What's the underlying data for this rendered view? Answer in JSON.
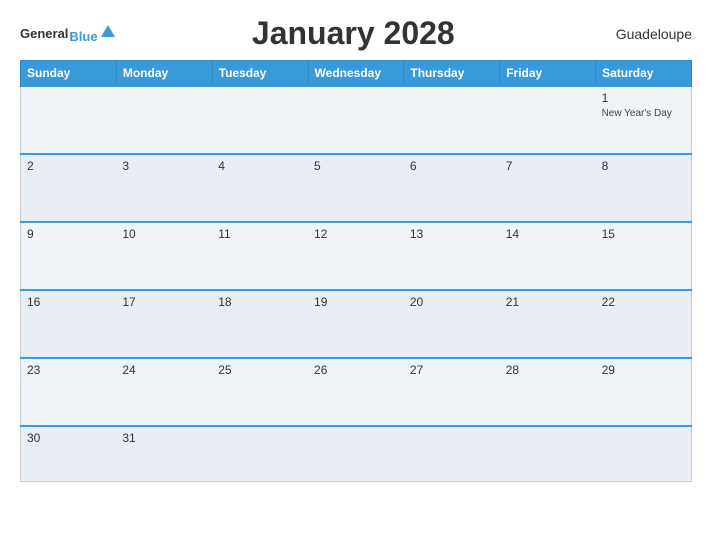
{
  "header": {
    "title": "January 2028",
    "region": "Guadeloupe",
    "logo": {
      "general": "General",
      "blue": "Blue"
    }
  },
  "days_of_week": [
    "Sunday",
    "Monday",
    "Tuesday",
    "Wednesday",
    "Thursday",
    "Friday",
    "Saturday"
  ],
  "weeks": [
    [
      {
        "date": "",
        "events": []
      },
      {
        "date": "",
        "events": []
      },
      {
        "date": "",
        "events": []
      },
      {
        "date": "",
        "events": []
      },
      {
        "date": "",
        "events": []
      },
      {
        "date": "",
        "events": []
      },
      {
        "date": "1",
        "events": [
          "New Year's Day"
        ]
      }
    ],
    [
      {
        "date": "2",
        "events": []
      },
      {
        "date": "3",
        "events": []
      },
      {
        "date": "4",
        "events": []
      },
      {
        "date": "5",
        "events": []
      },
      {
        "date": "6",
        "events": []
      },
      {
        "date": "7",
        "events": []
      },
      {
        "date": "8",
        "events": []
      }
    ],
    [
      {
        "date": "9",
        "events": []
      },
      {
        "date": "10",
        "events": []
      },
      {
        "date": "11",
        "events": []
      },
      {
        "date": "12",
        "events": []
      },
      {
        "date": "13",
        "events": []
      },
      {
        "date": "14",
        "events": []
      },
      {
        "date": "15",
        "events": []
      }
    ],
    [
      {
        "date": "16",
        "events": []
      },
      {
        "date": "17",
        "events": []
      },
      {
        "date": "18",
        "events": []
      },
      {
        "date": "19",
        "events": []
      },
      {
        "date": "20",
        "events": []
      },
      {
        "date": "21",
        "events": []
      },
      {
        "date": "22",
        "events": []
      }
    ],
    [
      {
        "date": "23",
        "events": []
      },
      {
        "date": "24",
        "events": []
      },
      {
        "date": "25",
        "events": []
      },
      {
        "date": "26",
        "events": []
      },
      {
        "date": "27",
        "events": []
      },
      {
        "date": "28",
        "events": []
      },
      {
        "date": "29",
        "events": []
      }
    ],
    [
      {
        "date": "30",
        "events": []
      },
      {
        "date": "31",
        "events": []
      },
      {
        "date": "",
        "events": []
      },
      {
        "date": "",
        "events": []
      },
      {
        "date": "",
        "events": []
      },
      {
        "date": "",
        "events": []
      },
      {
        "date": "",
        "events": []
      }
    ]
  ]
}
